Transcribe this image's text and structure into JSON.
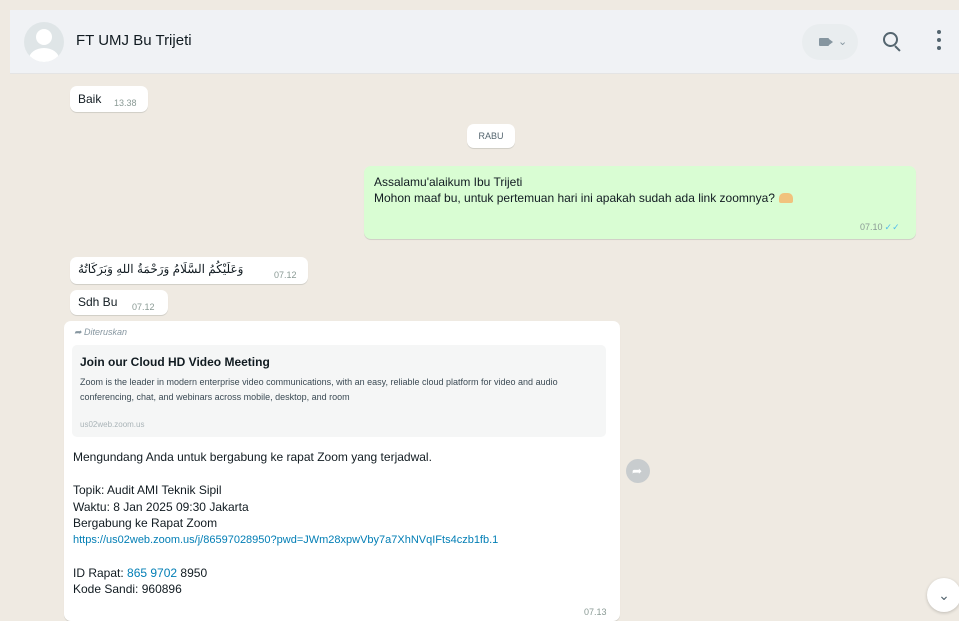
{
  "header": {
    "contact_name": "FT UMJ Bu Trijeti",
    "video_chevron": "⌄"
  },
  "messages": {
    "m1": {
      "text": "Baik",
      "time": "13.38"
    },
    "date_divider": "RABU",
    "m2": {
      "line1": "Assalamu'alaikum Ibu Trijeti",
      "line2": "Mohon maaf bu, untuk pertemuan hari ini apakah sudah ada link zoomnya?",
      "time": "07.10"
    },
    "m3": {
      "text": "وَعَلَيْكُمُ السَّلَامُ وَرَحْمَةُ اللهِ وَبَرَكَاتُهُ",
      "time": "07.12"
    },
    "m4": {
      "text": "Sdh Bu",
      "time": "07.12"
    },
    "m5": {
      "forwarded_label": "Diteruskan",
      "preview_title": "Join our Cloud HD Video Meeting",
      "preview_desc": "Zoom is the leader in modern enterprise video communications, with an easy, reliable cloud platform for video and audio conferencing, chat, and webinars across mobile, desktop, and room",
      "preview_domain": "us02web.zoom.us",
      "invite": "Mengundang Anda untuk bergabung ke rapat Zoom yang terjadwal.",
      "topic": "Topik: Audit AMI Teknik Sipil",
      "when": "Waktu: 8 Jan 2025 09:30 Jakarta",
      "join_label": "Bergabung ke Rapat Zoom",
      "link": "https://us02web.zoom.us/j/86597028950?pwd=JWm28xpwVby7a7XhNVqIFts4czb1fb.1",
      "meeting_id_label": "ID Rapat: ",
      "meeting_id_link": "865 9702",
      "meeting_id_rest": " 8950",
      "passcode": "Kode Sandi: 960896",
      "time": "07.13"
    }
  },
  "icons": {
    "avatar": "default-avatar-icon",
    "video": "video-call-icon",
    "search": "search-icon",
    "menu": "menu-dots-icon",
    "share": "share-forward-icon",
    "scroll_down": "chevron-down-icon"
  },
  "colors": {
    "chat_bg": "#efeae2",
    "outgoing_bubble": "#d9fdd3",
    "incoming_bubble": "#ffffff",
    "link": "#027eb5",
    "read_ticks": "#53bdeb"
  }
}
